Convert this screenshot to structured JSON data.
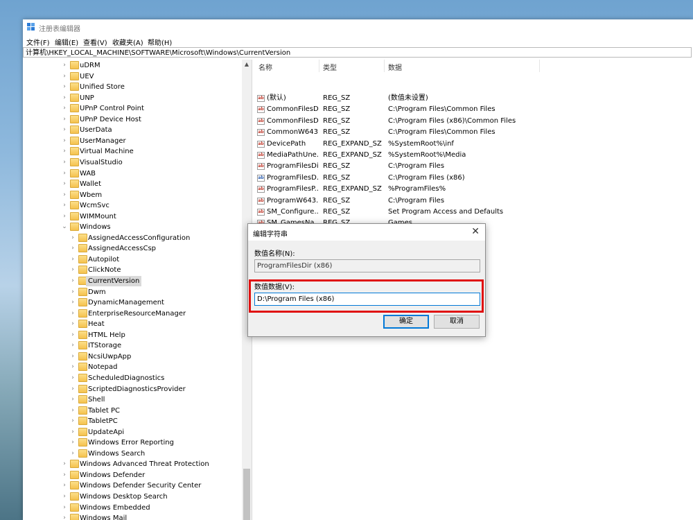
{
  "window": {
    "title": "注册表编辑器"
  },
  "menu": [
    "文件(F)",
    "编辑(E)",
    "查看(V)",
    "收藏夹(A)",
    "帮助(H)"
  ],
  "address": "计算机\\HKEY_LOCAL_MACHINE\\SOFTWARE\\Microsoft\\Windows\\CurrentVersion",
  "tree": {
    "items": [
      {
        "label": "uDRM",
        "depth": 0,
        "expanded": false,
        "selected": false
      },
      {
        "label": "UEV",
        "depth": 0,
        "expanded": false,
        "selected": false
      },
      {
        "label": "Unified Store",
        "depth": 0,
        "expanded": false,
        "selected": false
      },
      {
        "label": "UNP",
        "depth": 0,
        "expanded": false,
        "selected": false
      },
      {
        "label": "UPnP Control Point",
        "depth": 0,
        "expanded": false,
        "selected": false
      },
      {
        "label": "UPnP Device Host",
        "depth": 0,
        "expanded": false,
        "selected": false
      },
      {
        "label": "UserData",
        "depth": 0,
        "expanded": false,
        "selected": false
      },
      {
        "label": "UserManager",
        "depth": 0,
        "expanded": false,
        "selected": false
      },
      {
        "label": "Virtual Machine",
        "depth": 0,
        "expanded": false,
        "selected": false
      },
      {
        "label": "VisualStudio",
        "depth": 0,
        "expanded": false,
        "selected": false
      },
      {
        "label": "WAB",
        "depth": 0,
        "expanded": false,
        "selected": false
      },
      {
        "label": "Wallet",
        "depth": 0,
        "expanded": false,
        "selected": false
      },
      {
        "label": "Wbem",
        "depth": 0,
        "expanded": false,
        "selected": false
      },
      {
        "label": "WcmSvc",
        "depth": 0,
        "expanded": false,
        "selected": false
      },
      {
        "label": "WIMMount",
        "depth": 0,
        "expanded": false,
        "selected": false
      },
      {
        "label": "Windows",
        "depth": 0,
        "expanded": true,
        "selected": false
      },
      {
        "label": "AssignedAccessConfiguration",
        "depth": 1,
        "expanded": false,
        "selected": false
      },
      {
        "label": "AssignedAccessCsp",
        "depth": 1,
        "expanded": false,
        "selected": false
      },
      {
        "label": "Autopilot",
        "depth": 1,
        "expanded": false,
        "selected": false
      },
      {
        "label": "ClickNote",
        "depth": 1,
        "expanded": false,
        "selected": false
      },
      {
        "label": "CurrentVersion",
        "depth": 1,
        "expanded": false,
        "selected": true
      },
      {
        "label": "Dwm",
        "depth": 1,
        "expanded": false,
        "selected": false
      },
      {
        "label": "DynamicManagement",
        "depth": 1,
        "expanded": false,
        "selected": false
      },
      {
        "label": "EnterpriseResourceManager",
        "depth": 1,
        "expanded": false,
        "selected": false
      },
      {
        "label": "Heat",
        "depth": 1,
        "expanded": false,
        "selected": false
      },
      {
        "label": "HTML Help",
        "depth": 1,
        "expanded": false,
        "selected": false
      },
      {
        "label": "ITStorage",
        "depth": 1,
        "expanded": false,
        "selected": false
      },
      {
        "label": "NcsiUwpApp",
        "depth": 1,
        "expanded": false,
        "selected": false
      },
      {
        "label": "Notepad",
        "depth": 1,
        "expanded": false,
        "selected": false
      },
      {
        "label": "ScheduledDiagnostics",
        "depth": 1,
        "expanded": false,
        "selected": false
      },
      {
        "label": "ScriptedDiagnosticsProvider",
        "depth": 1,
        "expanded": false,
        "selected": false
      },
      {
        "label": "Shell",
        "depth": 1,
        "expanded": false,
        "selected": false
      },
      {
        "label": "Tablet PC",
        "depth": 1,
        "expanded": false,
        "selected": false
      },
      {
        "label": "TabletPC",
        "depth": 1,
        "expanded": false,
        "selected": false
      },
      {
        "label": "UpdateApi",
        "depth": 1,
        "expanded": false,
        "selected": false
      },
      {
        "label": "Windows Error Reporting",
        "depth": 1,
        "expanded": false,
        "selected": false
      },
      {
        "label": "Windows Search",
        "depth": 1,
        "expanded": false,
        "selected": false
      },
      {
        "label": "Windows Advanced Threat Protection",
        "depth": 0,
        "expanded": false,
        "selected": false
      },
      {
        "label": "Windows Defender",
        "depth": 0,
        "expanded": false,
        "selected": false
      },
      {
        "label": "Windows Defender Security Center",
        "depth": 0,
        "expanded": false,
        "selected": false
      },
      {
        "label": "Windows Desktop Search",
        "depth": 0,
        "expanded": false,
        "selected": false
      },
      {
        "label": "Windows Embedded",
        "depth": 0,
        "expanded": false,
        "selected": false
      },
      {
        "label": "Windows Mail",
        "depth": 0,
        "expanded": false,
        "selected": false
      }
    ]
  },
  "list": {
    "columns": [
      "名称",
      "类型",
      "数据"
    ],
    "rows": [
      {
        "name": "(默认)",
        "type": "REG_SZ",
        "data": "(数值未设置)",
        "icon": "string-value-icon"
      },
      {
        "name": "CommonFilesDir",
        "type": "REG_SZ",
        "data": "C:\\Program Files\\Common Files",
        "icon": "string-value-icon"
      },
      {
        "name": "CommonFilesD...",
        "type": "REG_SZ",
        "data": "C:\\Program Files (x86)\\Common Files",
        "icon": "string-value-icon"
      },
      {
        "name": "CommonW643...",
        "type": "REG_SZ",
        "data": "C:\\Program Files\\Common Files",
        "icon": "string-value-icon"
      },
      {
        "name": "DevicePath",
        "type": "REG_EXPAND_SZ",
        "data": "%SystemRoot%\\inf",
        "icon": "string-value-icon"
      },
      {
        "name": "MediaPathUne...",
        "type": "REG_EXPAND_SZ",
        "data": "%SystemRoot%\\Media",
        "icon": "string-value-icon"
      },
      {
        "name": "ProgramFilesDir",
        "type": "REG_SZ",
        "data": "C:\\Program Files",
        "icon": "string-value-icon"
      },
      {
        "name": "ProgramFilesD...",
        "type": "REG_SZ",
        "data": "C:\\Program Files (x86)",
        "icon": "expand-value-icon"
      },
      {
        "name": "ProgramFilesP...",
        "type": "REG_EXPAND_SZ",
        "data": "%ProgramFiles%",
        "icon": "string-value-icon"
      },
      {
        "name": "ProgramW643...",
        "type": "REG_SZ",
        "data": "C:\\Program Files",
        "icon": "string-value-icon"
      },
      {
        "name": "SM_Configure...",
        "type": "REG_SZ",
        "data": "Set Program Access and Defaults",
        "icon": "string-value-icon"
      },
      {
        "name": "SM_GamesNa...",
        "type": "REG_SZ",
        "data": "Games",
        "icon": "string-value-icon"
      }
    ]
  },
  "dialog": {
    "title": "编辑字符串",
    "name_label": "数值名称(N):",
    "name_value": "ProgramFilesDir (x86)",
    "data_label": "数值数据(V):",
    "data_value": "D:\\Program Files (x86)",
    "ok": "确定",
    "cancel": "取消"
  },
  "colors": {
    "highlight": "#e01010",
    "accent": "#0078d7"
  }
}
